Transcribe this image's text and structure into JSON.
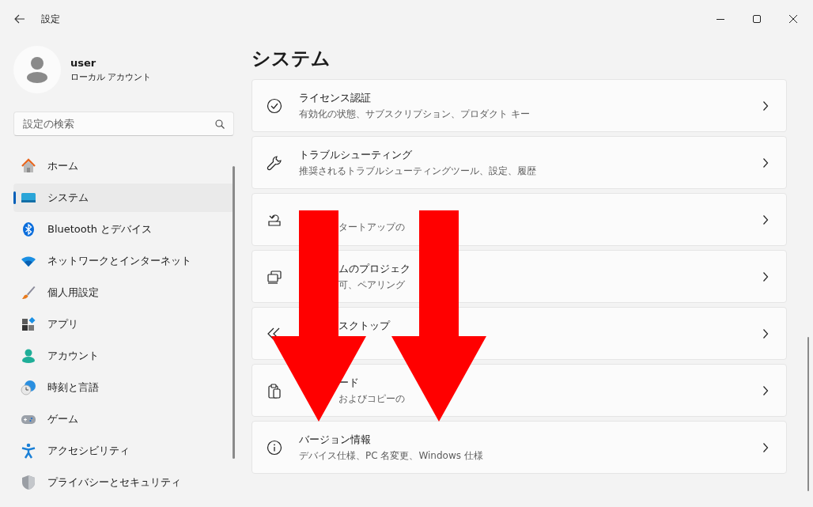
{
  "window": {
    "title": "設定"
  },
  "account": {
    "name": "user",
    "type": "ローカル アカウント"
  },
  "search": {
    "placeholder": "設定の検索"
  },
  "nav": [
    {
      "label": "ホーム",
      "selected": false,
      "kind": "home"
    },
    {
      "label": "システム",
      "selected": true,
      "kind": "system"
    },
    {
      "label": "Bluetooth とデバイス",
      "selected": false,
      "kind": "bluetooth"
    },
    {
      "label": "ネットワークとインターネット",
      "selected": false,
      "kind": "network"
    },
    {
      "label": "個人用設定",
      "selected": false,
      "kind": "brush"
    },
    {
      "label": "アプリ",
      "selected": false,
      "kind": "apps"
    },
    {
      "label": "アカウント",
      "selected": false,
      "kind": "person"
    },
    {
      "label": "時刻と言語",
      "selected": false,
      "kind": "time"
    },
    {
      "label": "ゲーム",
      "selected": false,
      "kind": "gamepad"
    },
    {
      "label": "アクセシビリティ",
      "selected": false,
      "kind": "accessibility"
    },
    {
      "label": "プライバシーとセキュリティ",
      "selected": false,
      "kind": "shield"
    }
  ],
  "page_title": "システム",
  "settings": [
    {
      "kind": "check",
      "title": "ライセンス認証",
      "description": "有効化の状態、サブスクリプション、プロダクト キー",
      "obscured": false
    },
    {
      "kind": "wrench",
      "title": "トラブルシューティング",
      "description": "推奨されるトラブルシューティングツール、設定、履歴",
      "obscured": false
    },
    {
      "kind": "recovery",
      "description": "タートアップの",
      "obscured": true
    },
    {
      "kind": "projection",
      "title": "ムのプロジェク",
      "description": "可、ペアリング",
      "obscured": true
    },
    {
      "kind": "remote",
      "title": "スクトップ",
      "obscured": true
    },
    {
      "kind": "clipboard",
      "title": "ード",
      "description": "およびコピーの",
      "obscured": true
    },
    {
      "kind": "info",
      "title": "バージョン情報",
      "description": "デバイス仕様、PC 名変更、Windows 仕様",
      "obscured": false
    }
  ],
  "annotations": [
    {
      "kind": "arrow"
    },
    {
      "kind": "arrow"
    }
  ]
}
